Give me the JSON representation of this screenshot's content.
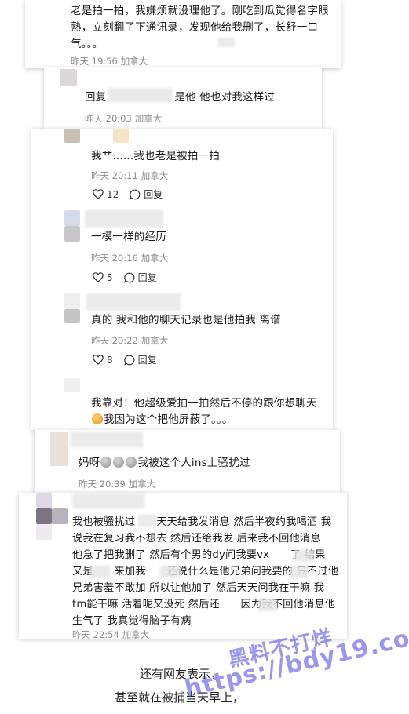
{
  "comments": [
    {
      "id": "c1",
      "text_lines": [
        "老是拍一拍，我嫌烦就没理他了。刚吃到瓜觉得名字眼",
        "熟，立刻翻了下通讯录，发现他给我删了，长舒一口",
        "气。。。"
      ],
      "time": "昨天 19:56",
      "location": "加拿大"
    },
    {
      "id": "c2",
      "text_prefix": "回复",
      "text_suffix": "是他 他也对我这样过",
      "time": "昨天 20:03",
      "location": "加拿大"
    },
    {
      "id": "c3",
      "text": "我艹......我也老是被拍一拍",
      "time": "昨天 20:11",
      "location": "加拿大",
      "likes": "12",
      "reply_label": "回复"
    },
    {
      "id": "c4",
      "text": "一模一样的经历",
      "time": "昨天 20:16",
      "location": "加拿大",
      "likes": "5",
      "reply_label": "回复"
    },
    {
      "id": "c5",
      "text": "真的 我和他的聊天记录也是他拍我 离谱",
      "time": "昨天 20:22",
      "location": "加拿大",
      "likes": "8",
      "reply_label": "回复"
    },
    {
      "id": "c6",
      "text_line1": "我靠对！他超级爱拍一拍然后不停的跟你想聊天",
      "text_line2": "我因为这个把他屏蔽了。。。"
    },
    {
      "id": "c7",
      "text_prefix": "妈呀",
      "text_suffix": "我被这个人ins上骚扰过",
      "time": "昨天 20:39",
      "location": "加拿大"
    },
    {
      "id": "c8",
      "text_lines": [
        "我也被骚扰过　　天天给我发消息 然后半夜约我喝酒 我",
        "说我在复习我不想去 然后还给我发 后来我不回他消息",
        "他急了把我删了 然后有个男的dy问我要vx　　了 结果",
        "又是　　来加我　　还说什么是他兄弟问我要的 只不过他",
        "兄弟害羞不敢加 所以让他加了 然后天天问我在干嘛 我",
        "tm能干嘛 活着呢又没死 然后还　　因为我不回他消息他",
        "生气了 我真觉得脑子有病"
      ],
      "time": "昨天 22:54",
      "location": "加拿大"
    }
  ],
  "footer": {
    "line1": "还有网友表示，",
    "line2": "甚至就在被捕当天早上，"
  },
  "watermark": {
    "line1": "黑料不打烊",
    "line2": "https://bdy19.co"
  }
}
